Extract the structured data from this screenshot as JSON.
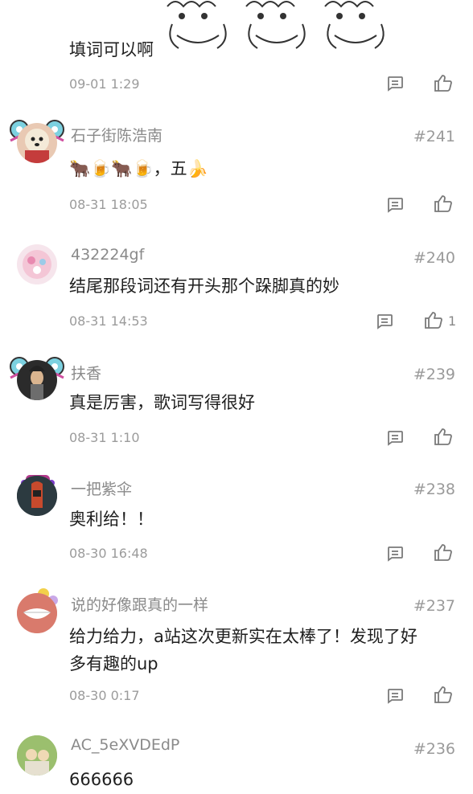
{
  "top": {
    "text": "填词可以啊",
    "time": "09-01 1:29"
  },
  "comments": [
    {
      "user": "石子街陈浩南",
      "floor": "#241",
      "text": "🐂🍺🐂🍺，五🍌",
      "time": "08-31 18:05",
      "likes": ""
    },
    {
      "user": "432224gf",
      "floor": "#240",
      "text": "结尾那段词还有开头那个跺脚真的妙",
      "time": "08-31 14:53",
      "likes": "1"
    },
    {
      "user": "扶香",
      "floor": "#239",
      "text": "真是厉害，歌词写得很好",
      "time": "08-31 1:10",
      "likes": ""
    },
    {
      "user": "一把紫伞",
      "floor": "#238",
      "text": "奥利给！！",
      "time": "08-30 16:48",
      "likes": ""
    },
    {
      "user": "说的好像跟真的一样",
      "floor": "#237",
      "text_line1": "给力给力，a站这次更新实在太棒了！发现了好",
      "text_line2": "多有趣的up",
      "time": "08-30 0:17",
      "likes": ""
    },
    {
      "user": "AC_5eXVDEdP",
      "floor": "#236",
      "text": "666666"
    }
  ],
  "colors": {
    "text": "#1f1f1f",
    "meta": "#9b9b9b",
    "icon": "#7a7a7a"
  }
}
